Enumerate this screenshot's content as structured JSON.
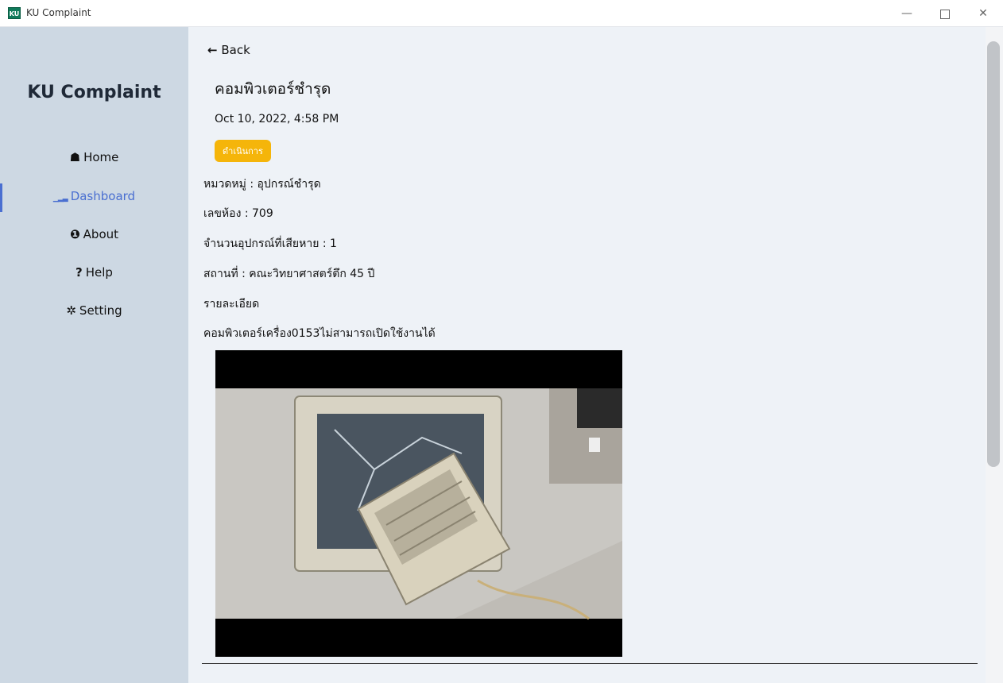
{
  "window": {
    "title": "KU Complaint",
    "icon_text": "KU",
    "minimize": "—",
    "close": "✕"
  },
  "sidebar": {
    "brand": "KU Complaint",
    "items": [
      {
        "icon": "☗",
        "label": "Home"
      },
      {
        "icon": "▁▂▃",
        "label": "Dashboard"
      },
      {
        "icon": "❶",
        "label": "About"
      },
      {
        "icon": "?",
        "label": "Help"
      },
      {
        "icon": "✲",
        "label": "Setting"
      }
    ],
    "active_item": "Dashboard"
  },
  "main": {
    "back_icon": "←",
    "back_label": "Back",
    "title": "คอมพิวเตอร์ชำรุด",
    "datetime": "Oct 10, 2022, 4:58 PM",
    "status": "ดำเนินการ",
    "fields": [
      "หมวดหมู่ : อุปกรณ์ชำรุด",
      "เลขห้อง : 709",
      "จำนวนอุปกรณ์ที่เสียหาย : 1",
      "สถานที่ : คณะวิทยาศาสตร์ตึก 45 ปี",
      "รายละเอียด",
      "คอมพิวเตอร์เครื่อง0153ไม่สามารถเปิดใช้งานได้"
    ]
  },
  "colors": {
    "accent": "#4a6fd1",
    "status_badge": "#f5b50a",
    "sidebar_bg": "#cdd8e3",
    "content_bg": "#eef2f7"
  }
}
